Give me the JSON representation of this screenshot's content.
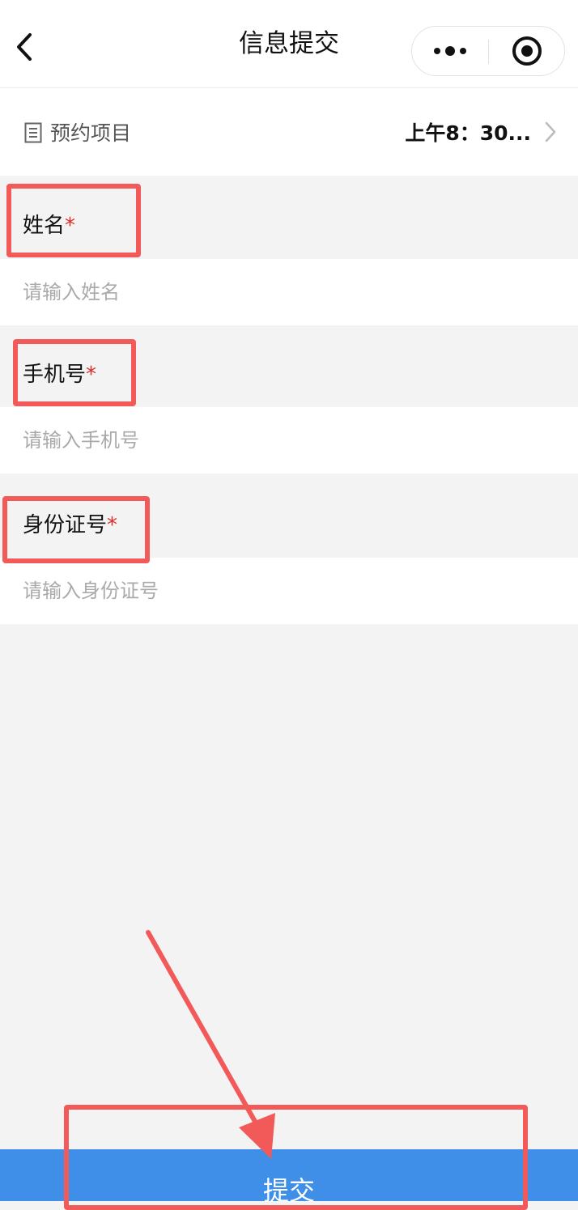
{
  "nav": {
    "title": "信息提交",
    "back_icon": "chevron-left-icon",
    "more_icon": "more-dots-icon",
    "close_icon": "target-circle-icon"
  },
  "booking": {
    "label": "预约项目",
    "value": "上午8：30...",
    "icon": "document-list-icon"
  },
  "form": {
    "name": {
      "label": "姓名",
      "required": "*",
      "placeholder": "请输入姓名"
    },
    "phone": {
      "label": "手机号",
      "required": "*",
      "placeholder": "请输入手机号"
    },
    "id_number": {
      "label": "身份证号",
      "required": "*",
      "placeholder": "请输入身份证号"
    }
  },
  "submit": {
    "label": "提交"
  },
  "colors": {
    "accent": "#3f8fe8",
    "required": "#d9302c",
    "annotation": "#f25a5a",
    "background": "#f3f3f3"
  }
}
